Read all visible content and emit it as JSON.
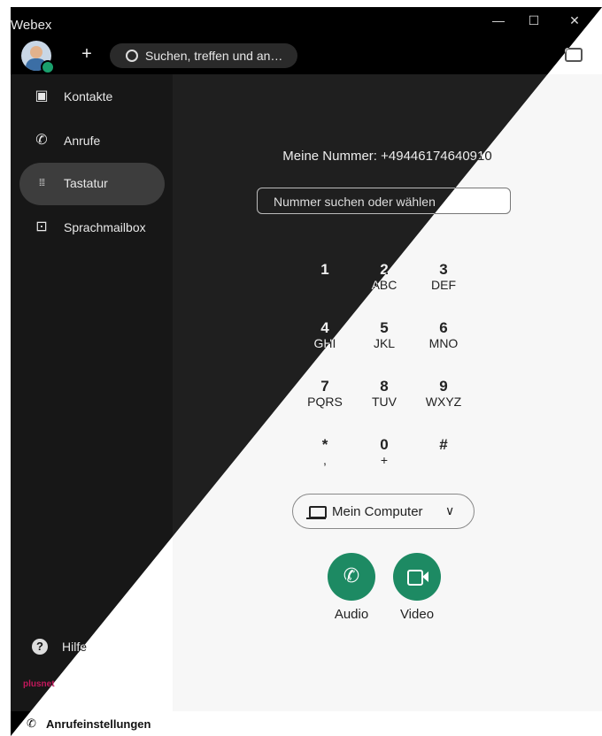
{
  "window": {
    "title": "Webex",
    "controls": {
      "minimize": "—",
      "maximize": "☐",
      "close": "✕"
    }
  },
  "header": {
    "add_label": "+",
    "search_placeholder": "Suchen, treffen und an…"
  },
  "sidebar": {
    "items": [
      {
        "label": "Kontakte",
        "icon": "contacts-icon",
        "glyph": "▣"
      },
      {
        "label": "Anrufe",
        "icon": "phone-icon",
        "glyph": "✆"
      },
      {
        "label": "Tastatur",
        "icon": "dialpad-icon",
        "glyph": "⁞⁞⁞",
        "active": true
      },
      {
        "label": "Sprachmailbox",
        "icon": "voicemail-icon",
        "glyph": "⊡"
      }
    ],
    "help_label": "Hilfe",
    "help_glyph": "?",
    "brand": "plusnet"
  },
  "footer": {
    "call_settings_label": "Anrufeinstellungen",
    "call_settings_glyph": "✆"
  },
  "dialer": {
    "my_number_text": "Meine Nummer: +49446174640910",
    "input_placeholder": "Nummer suchen oder wählen",
    "keys": [
      {
        "digit": "1",
        "letters": ""
      },
      {
        "digit": "2",
        "letters": "ABC"
      },
      {
        "digit": "3",
        "letters": "DEF"
      },
      {
        "digit": "4",
        "letters": "GHI"
      },
      {
        "digit": "5",
        "letters": "JKL"
      },
      {
        "digit": "6",
        "letters": "MNO"
      },
      {
        "digit": "7",
        "letters": "PQRS"
      },
      {
        "digit": "8",
        "letters": "TUV"
      },
      {
        "digit": "9",
        "letters": "WXYZ"
      },
      {
        "digit": "*",
        "letters": ","
      },
      {
        "digit": "0",
        "letters": "+"
      },
      {
        "digit": "#",
        "letters": ""
      }
    ],
    "device_label": "Mein Computer",
    "device_chevron": "∨",
    "audio_label": "Audio",
    "video_label": "Video",
    "audio_glyph": "✆"
  },
  "colors": {
    "accent_green": "#1d8a63",
    "brand_pink": "#c2185b"
  }
}
